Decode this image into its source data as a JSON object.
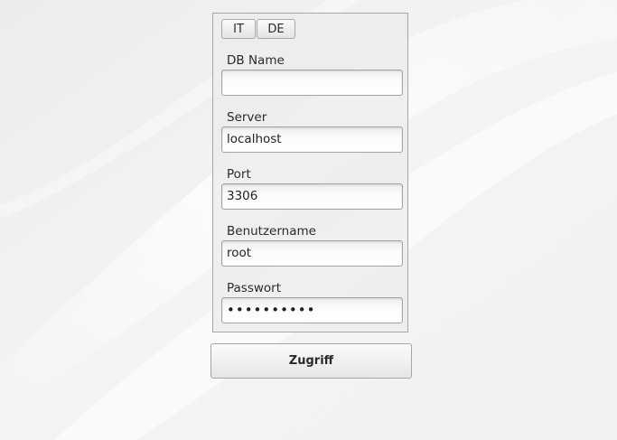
{
  "language_buttons": {
    "it_label": "IT",
    "de_label": "DE"
  },
  "form": {
    "db_name": {
      "label": "DB Name",
      "value": ""
    },
    "server": {
      "label": "Server",
      "value": "localhost"
    },
    "port": {
      "label": "Port",
      "value": "3306"
    },
    "username": {
      "label": "Benutzername",
      "value": "root"
    },
    "password": {
      "label": "Passwort",
      "masked_value": "••••••••••"
    }
  },
  "submit_label": "Zugriff",
  "colors": {
    "background": "#f0f0f0",
    "panel_border": "#a6a6a6",
    "text": "#2a2a2a"
  }
}
